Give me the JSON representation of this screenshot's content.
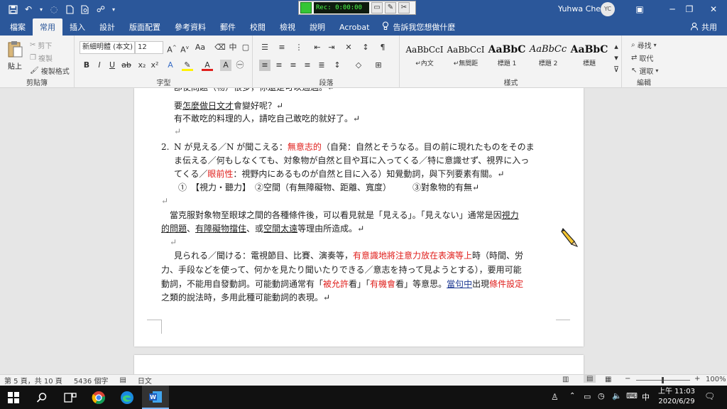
{
  "titlebar": {
    "recorder_time": "Rec: 0:00:00",
    "user_name": "Yuhwa Chen",
    "user_initials": "YC"
  },
  "tabs": [
    "檔案",
    "常用",
    "插入",
    "設計",
    "版面配置",
    "參考資料",
    "郵件",
    "校閱",
    "檢視",
    "說明",
    "Acrobat"
  ],
  "tell_me": "告訴我您想做什麼",
  "share": "共用",
  "ribbon": {
    "clipboard": {
      "paste": "貼上",
      "cut": "剪下",
      "copy": "複製",
      "format_painter": "複製格式",
      "label": "剪貼簿"
    },
    "font": {
      "name": "新細明體 (本文)",
      "size": "12",
      "aa": "Aa",
      "label": "字型"
    },
    "paragraph": {
      "label": "段落"
    },
    "styles": {
      "items": [
        {
          "sample": "AaBbCcI",
          "name": "↵內文"
        },
        {
          "sample": "AaBbCcI",
          "name": "↵無間距"
        },
        {
          "sample": "AaBbC",
          "name": "標題 1"
        },
        {
          "sample": "AaBbCc",
          "name": "標題 2"
        },
        {
          "sample": "AaBbC",
          "name": "標題"
        }
      ],
      "label": "樣式"
    },
    "editing": {
      "find": "尋找",
      "replace": "取代",
      "select": "選取",
      "label": "編輯"
    }
  },
  "doc": {
    "l0": "卽使問題（物）很多，你還是可以通過。↵",
    "l1_a": "要",
    "l1_b": "怎麼做日文才",
    "l1_c": "會變好呢？↵",
    "l2": "有不敢吃的料理的人，請吃自己敢吃的就好了。↵",
    "l3": "↵",
    "l4_num": "2.",
    "l4_a": "N が見える／N が聞こえる：",
    "l4_b": "無意志的",
    "l4_c": "（自発：自然とそうなる。目の前に現れたものをそのま",
    "l5": "ま伝える／何もしなくても、対象物が自然と目や耳に入ってくる／特に意識せず、視界に入っ",
    "l6_a": "てくる／",
    "l6_b": "眼前性",
    "l6_c": "：視野内にあるものが自然と目に入る）知覺動詞，與下列要素有關。↵",
    "l7_a": "①　【視力・聽力】　②空間（有無障礙物、距離、寬度）　　　③對象物的有無↵",
    "l8": "↵",
    "l9_a": "當克服對象物至眼球之間的各種條件後，可以看見就是「見える」。「見えない」通常是因",
    "l9_b": "視力",
    "l10_a": "的問題",
    "l10_b": "、",
    "l10_c": "有障礙物擋住",
    "l10_d": "、或",
    "l10_e": "空間太遠",
    "l10_f": "等理由所造成。↵",
    "l11": "↵",
    "l12_a": "見られる／聞ける：電視節目、比賽、演奏等，",
    "l12_b": "有意識地將注意力放在表演等上",
    "l12_c": "時（時間、労",
    "l13": "力、手段などを使って、何かを見たり聞いたりできる／意志を持って見ようとする），要用可能",
    "l14_a": "動詞，不能用自發動詞。可能動詞通常有「",
    "l14_b": "被允許",
    "l14_c": "看」「",
    "l14_d": "有機會",
    "l14_e": "看」等意思。",
    "l14_f": "當句中",
    "l14_g": "出現",
    "l14_h": "條件設定",
    "l15": "之類的說法時，多用此種可能動詞的表現。↵"
  },
  "status": {
    "page": "第 5 頁，共 10 頁",
    "words": "5436 個字",
    "lang": "日文",
    "zoom": "100%"
  },
  "taskbar": {
    "time": "上午 11:03",
    "date": "2020/6/29"
  },
  "colors": {
    "accent": "#2b579a",
    "red_text": "#e0201d"
  }
}
